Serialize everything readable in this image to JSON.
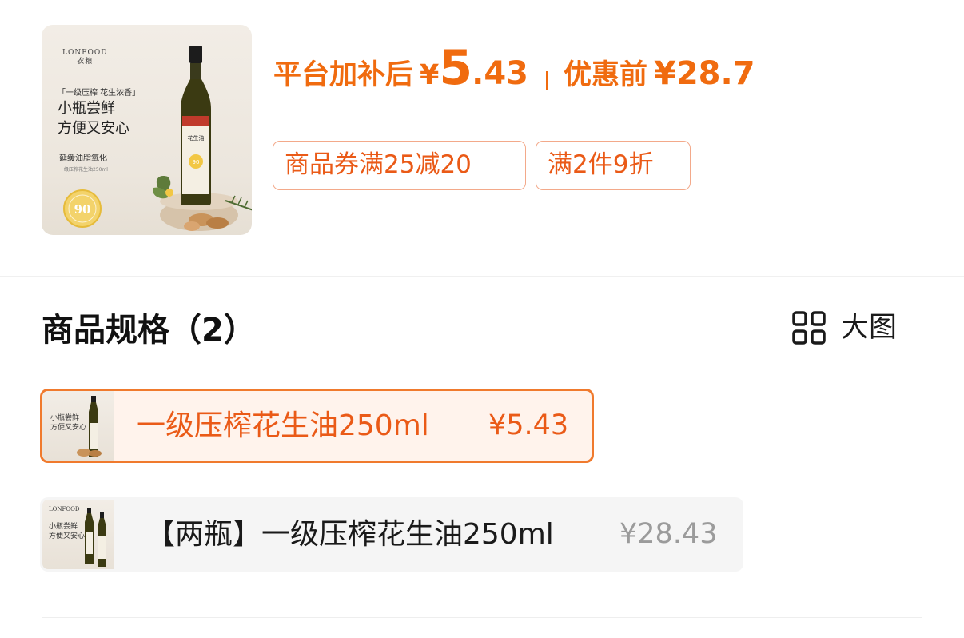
{
  "product_image": {
    "brand": "LONFOOD",
    "brand_cn": "农粮",
    "tagline": "「一级压榨 花生浓香」",
    "slogan_line1": "小瓶尝鲜",
    "slogan_line2": "方便又安心",
    "sub_feature": "延缓油脂氧化",
    "small_text": "一级压榨花生油250ml",
    "seal_text": "90",
    "bottle_label": "花生油"
  },
  "price": {
    "label": "平台加补后",
    "currency": "¥",
    "integer": "5",
    "decimal": ".43",
    "original_label": "优惠前",
    "original_price": "¥28.7"
  },
  "coupons": [
    {
      "label": "商品券满25减20"
    },
    {
      "label": "满2件9折"
    }
  ],
  "spec_section": {
    "title": "商品规格（2）",
    "view_toggle_label": "大图",
    "view_toggle_icon": "grid-icon"
  },
  "specs": [
    {
      "name": "一级压榨花生油250ml",
      "price": "¥5.43",
      "selected": true
    },
    {
      "name": "【两瓶】一级压榨花生油250ml",
      "price": "¥28.43",
      "selected": false
    }
  ],
  "colors": {
    "accent": "#f06b0f",
    "accent_text": "#ea5a17",
    "selected_bg": "#fff3ec",
    "unselected_bg": "#f5f5f5"
  }
}
